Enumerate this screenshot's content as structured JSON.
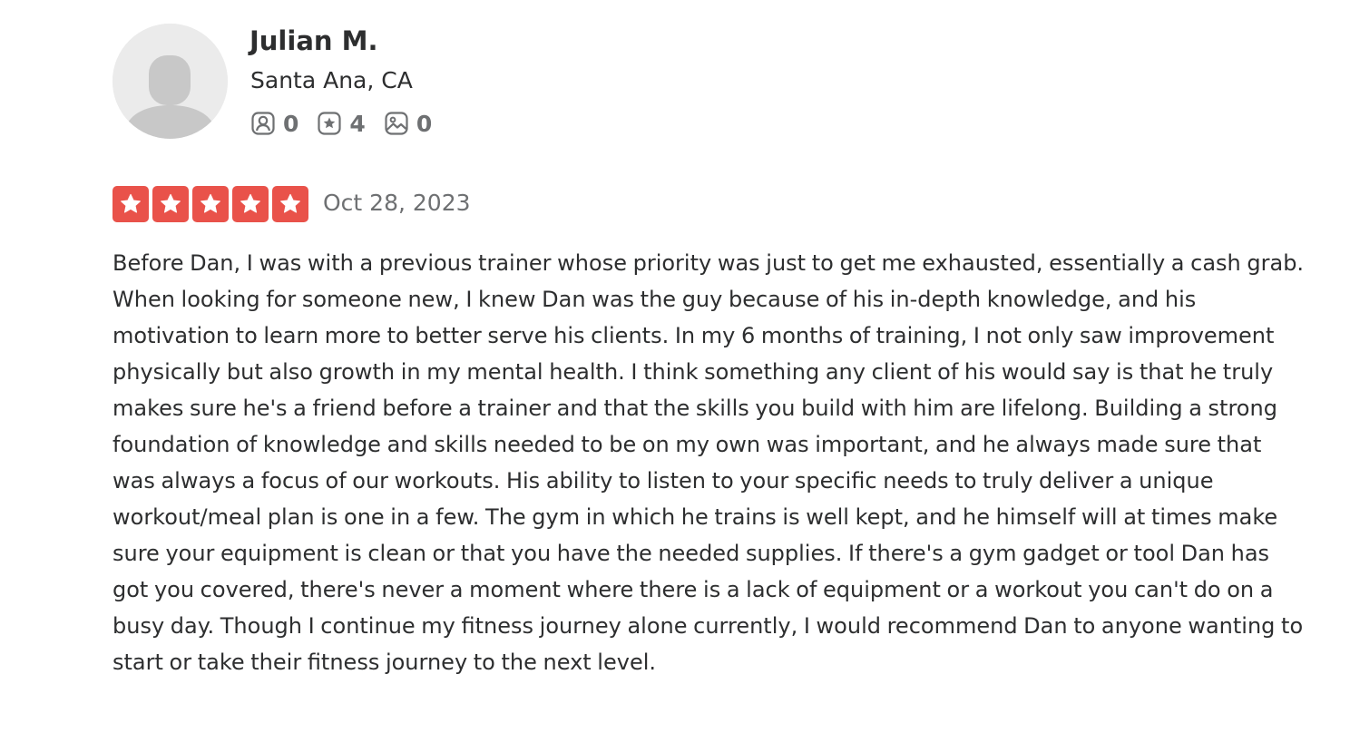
{
  "reviewer": {
    "name": "Julian M.",
    "location": "Santa Ana, CA",
    "stats": {
      "friends": "0",
      "reviews": "4",
      "photos": "0"
    }
  },
  "review": {
    "rating": 5,
    "rating_max": 5,
    "date": "Oct 28, 2023",
    "text": "Before Dan, I was with a previous trainer whose priority was just to get me exhausted, essentially a cash grab. When looking for someone new, I knew Dan was the guy because of his in-depth knowledge, and his motivation to learn more to better serve his clients. In my 6 months of training, I not only saw improvement physically but also growth in my mental health. I think something any client of his would say is that he truly makes sure he's a friend before a trainer and that the skills you build with him are lifelong. Building a strong foundation of knowledge and skills needed to be on my own was important, and he always made sure that was always a focus of our workouts. His ability to listen to your specific needs to truly deliver a unique workout/meal plan is one in a few. The gym in which he trains is well kept, and he himself will at times make sure your equipment is clean or that you have the needed supplies. If there's a gym gadget or tool Dan has got you covered, there's never a moment where there is a lack of equipment or a workout you can't do on a busy day. Though I continue my fitness journey alone currently, I would recommend Dan to anyone wanting to start or take their fitness journey to the next level."
  },
  "colors": {
    "star_red": "#e9524a",
    "text_dark": "#2d2e2f",
    "text_gray": "#6e7072",
    "avatar_bg": "#ebebeb",
    "avatar_figure": "#c8c8c8"
  },
  "icons": {
    "friends": "friends-icon",
    "reviews": "review-star-icon",
    "photos": "photo-icon",
    "star": "star-icon",
    "avatar": "default-user-avatar"
  }
}
